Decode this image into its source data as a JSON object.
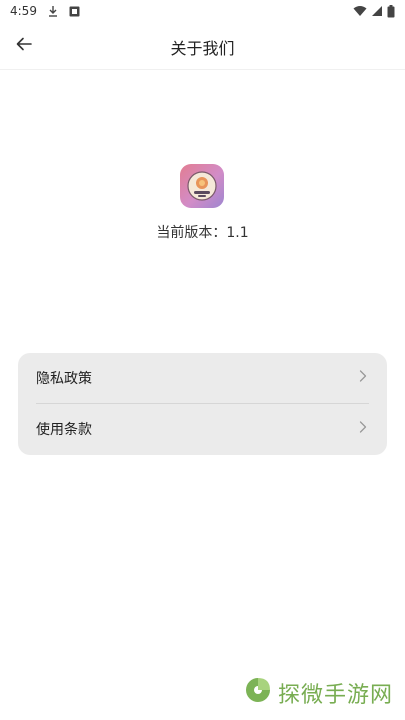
{
  "status_bar": {
    "time": "4:59",
    "icons": [
      "download-icon",
      "notification-icon",
      "wifi-icon",
      "signal-icon",
      "battery-icon"
    ]
  },
  "header": {
    "title": "关于我们",
    "back_icon": "arrow-left-icon"
  },
  "app_info": {
    "logo_icon": "app-logo-icon",
    "version_text": "当前版本：1.1"
  },
  "menu": {
    "items": [
      {
        "label": "隐私政策",
        "icon": "chevron-right-icon"
      },
      {
        "label": "使用条款",
        "icon": "chevron-right-icon"
      }
    ]
  },
  "watermark": {
    "text": "探微手游网",
    "color": "#78ad52"
  },
  "colors": {
    "background": "#ffffff",
    "card": "#ebebeb",
    "logo_gradient_start": "#e27d92",
    "logo_gradient_end": "#9e86d0"
  }
}
